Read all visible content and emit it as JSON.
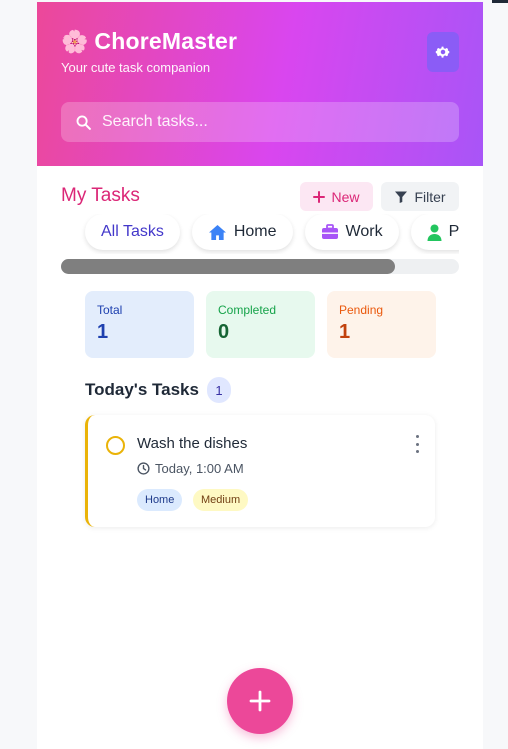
{
  "header": {
    "title": "ChoreMaster",
    "subtitle": "Your cute task companion",
    "search_placeholder": "Search tasks..."
  },
  "toolbar": {
    "page_title": "My Tasks",
    "new_label": "New",
    "filter_label": "Filter"
  },
  "filters": [
    {
      "label": "All Tasks",
      "icon": "none",
      "active": true
    },
    {
      "label": "Home",
      "icon": "home-icon",
      "color": "#3b82f6"
    },
    {
      "label": "Work",
      "icon": "briefcase-icon",
      "color": "#a855f7"
    },
    {
      "label": "P",
      "icon": "person-icon",
      "color": "#22c55e"
    }
  ],
  "filter_scroll": {
    "visible_fraction": 0.84
  },
  "stats": [
    {
      "label": "Total",
      "value": "1"
    },
    {
      "label": "Completed",
      "value": "0"
    },
    {
      "label": "Pending",
      "value": "1"
    }
  ],
  "section": {
    "title": "Today's Tasks",
    "count": "1"
  },
  "tasks": [
    {
      "title": "Wash the dishes",
      "time": "Today, 1:00 AM",
      "category": "Home",
      "priority": "Medium",
      "accent": "#eab308"
    }
  ],
  "colors": {
    "brand_pink": "#ec4899",
    "brand_purple": "#a855f7",
    "title_pink": "#db2777"
  },
  "icons": {
    "brand": "flower-icon",
    "settings": "gear-icon",
    "search": "search-icon",
    "new": "plus-icon",
    "filter": "funnel-icon",
    "time": "clock-icon",
    "menu": "kebab-menu-icon",
    "fab": "plus-icon"
  }
}
